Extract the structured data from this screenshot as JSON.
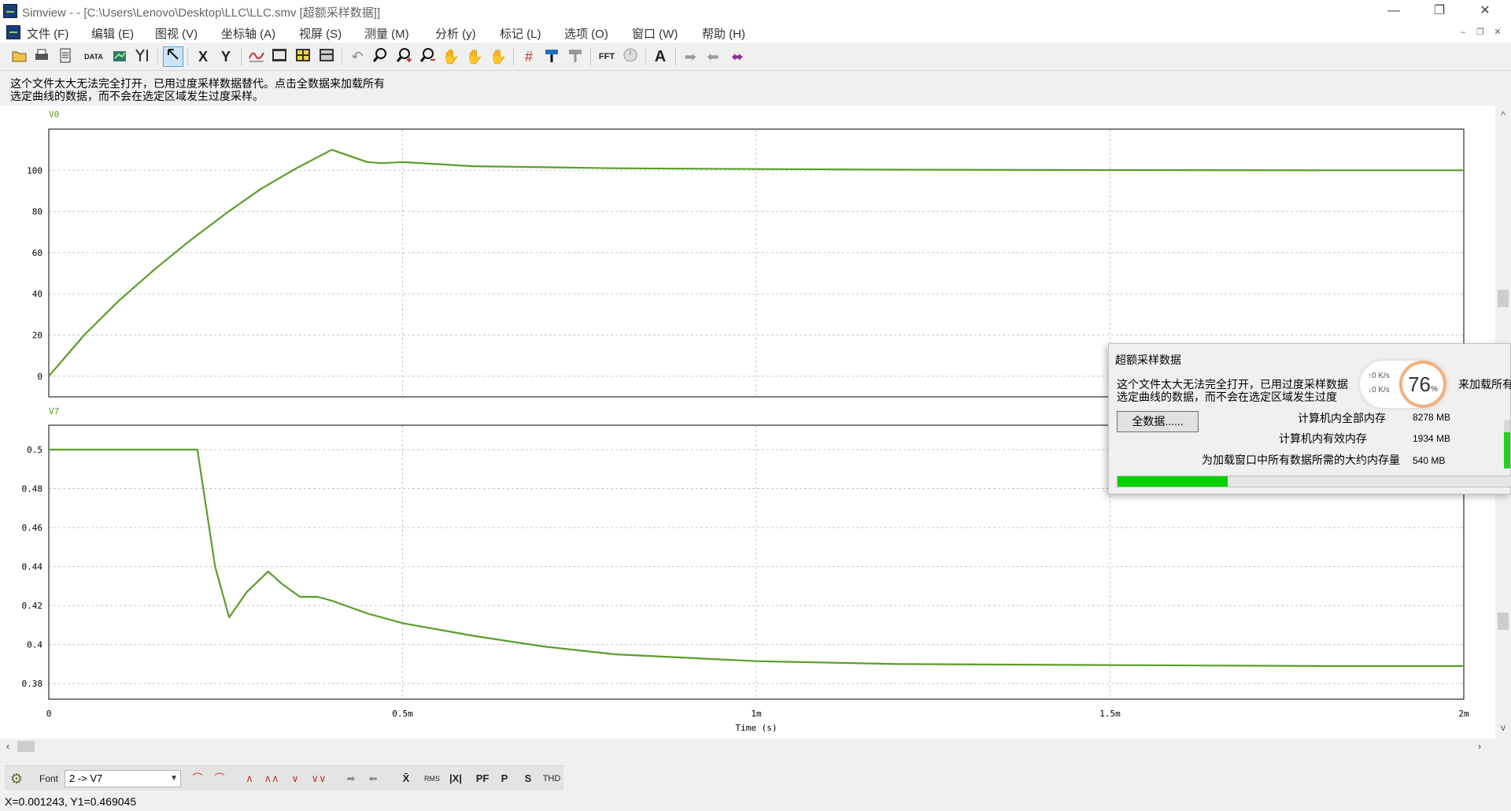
{
  "window": {
    "title": "Simview -  - [C:\\Users\\Lenovo\\Desktop\\LLC\\LLC.smv [超额采样数据]]",
    "controls": {
      "minimize": "—",
      "restore": "❐",
      "close": "✕"
    }
  },
  "menu": {
    "items": [
      "文件 (F)",
      "编辑 (E)",
      "图视 (V)",
      "坐标轴 (A)",
      "视屏 (S)",
      "测量 (M)",
      "分析 (y)",
      "标记 (L)",
      "选项 (O)",
      "窗口 (W)",
      "帮助 (H)"
    ],
    "mdi_controls": {
      "minimize": "–",
      "restore": "❐",
      "close": "✕"
    }
  },
  "toolbar": {
    "data_label": "DATA",
    "x_label": "X",
    "y_label": "Y",
    "fft_label": "FFT",
    "text_label": "A"
  },
  "message": {
    "line1": "这个文件太大无法完全打开，已用过度采样数据替代。点击全数据来加载所有",
    "line2": "选定曲线的数据，而不会在选定区域发生过度采样。"
  },
  "chart_data": [
    {
      "type": "line",
      "series": [
        {
          "name": "V0",
          "color": "#5a9e2a",
          "x": [
            0,
            5e-05,
            0.0001,
            0.00015,
            0.0002,
            0.00025,
            0.0003,
            0.00035,
            0.0004,
            0.00045,
            0.00047,
            0.0005,
            0.00055,
            0.0006,
            0.0007,
            0.0008,
            0.001,
            0.0012,
            0.0015,
            0.0018,
            0.002
          ],
          "y": [
            0,
            20,
            37,
            52,
            66,
            79,
            91,
            101,
            110,
            104,
            103.5,
            104,
            103,
            102,
            101.5,
            101,
            100.6,
            100.3,
            100.1,
            100,
            100
          ]
        }
      ],
      "ylabel": "V0",
      "yticks": [
        0,
        20,
        40,
        60,
        80,
        100
      ],
      "ylim": [
        -10,
        120
      ],
      "xlim": [
        0,
        0.002
      ],
      "grid": true
    },
    {
      "type": "line",
      "series": [
        {
          "name": "V7",
          "color": "#5a9e2a",
          "x": [
            0,
            0.00021,
            0.000235,
            0.000255,
            0.00028,
            0.00031,
            0.00033,
            0.000355,
            0.00038,
            0.0004,
            0.00045,
            0.0005,
            0.0006,
            0.0007,
            0.0008,
            0.001,
            0.0012,
            0.0015,
            0.0018,
            0.002
          ],
          "y": [
            0.5,
            0.5,
            0.44,
            0.414,
            0.427,
            0.4375,
            0.431,
            0.4245,
            0.4245,
            0.4225,
            0.416,
            0.411,
            0.4045,
            0.399,
            0.395,
            0.3915,
            0.39,
            0.3895,
            0.389,
            0.389
          ]
        }
      ],
      "ylabel": "V7",
      "yticks": [
        0.38,
        0.4,
        0.42,
        0.44,
        0.46,
        0.48,
        0.5
      ],
      "ylim": [
        0.372,
        0.5125
      ],
      "xlim": [
        0,
        0.002
      ],
      "grid": true
    }
  ],
  "x_axis": {
    "ticks": [
      "0",
      "0.5m",
      "1m",
      "1.5m",
      "2m"
    ],
    "label": "Time (s)"
  },
  "dialog": {
    "title": "超额采样数据",
    "msg1": "这个文件太大无法完全打开，已用过度采样数据",
    "msg1_tail": "来加载所有",
    "msg2": "选定曲线的数据，而不会在选定区域发生过度",
    "button": "全数据......",
    "mem_total_label": "计算机内全部内存",
    "mem_total": "8278 MB",
    "mem_avail_label": "计算机内有效内存",
    "mem_avail": "1934 MB",
    "mem_needed_label": "为加载窗口中所有数据所需的大约内存量",
    "mem_needed": "540 MB",
    "progress": 0.28,
    "side_level": 0.75
  },
  "netwidget": {
    "up": "0  K/s",
    "down": "0  K/s",
    "percent": "76",
    "percent_unit": "%"
  },
  "bottombar": {
    "font_label": "Font",
    "curve_selected": "2 -> V7",
    "labels": [
      "RMS",
      "PF",
      "P",
      "S",
      "THD"
    ]
  },
  "status": {
    "coords": "X=0.001243, Y1=0.469045"
  }
}
